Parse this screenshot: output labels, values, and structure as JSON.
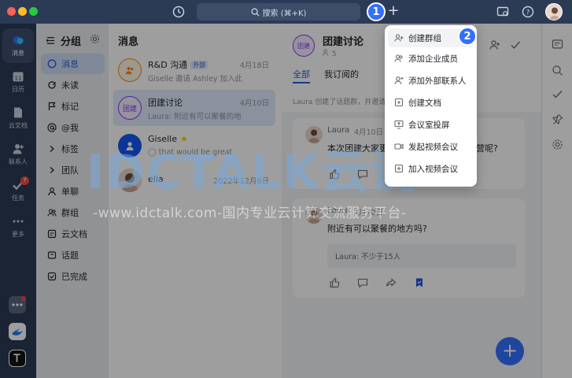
{
  "titlebar": {
    "search_placeholder": "搜索 (⌘+K)",
    "plus_label": "+"
  },
  "rail": {
    "items": [
      {
        "label": "消息",
        "icon": "message-icon",
        "active": true
      },
      {
        "label": "日历",
        "icon": "calendar-icon",
        "calendar_day": "11"
      },
      {
        "label": "云文档",
        "icon": "doc-icon"
      },
      {
        "label": "联系人",
        "icon": "contacts-icon"
      },
      {
        "label": "任务",
        "icon": "task-icon",
        "badge": "7"
      },
      {
        "label": "更多",
        "icon": "more-icon"
      }
    ]
  },
  "groups": {
    "title": "分组",
    "items": [
      {
        "label": "消息",
        "icon": "chat-bubble-icon",
        "active": true
      },
      {
        "label": "未读",
        "icon": "unread-icon"
      },
      {
        "label": "标记",
        "icon": "flag-icon"
      },
      {
        "label": "@我",
        "icon": "at-icon"
      },
      {
        "label": "标签",
        "icon": "tag-icon"
      },
      {
        "label": "团队",
        "icon": "team-icon"
      },
      {
        "label": "单聊",
        "icon": "single-chat-icon"
      },
      {
        "label": "群组",
        "icon": "group-icon"
      },
      {
        "label": "云文档",
        "icon": "cloud-doc-icon"
      },
      {
        "label": "话题",
        "icon": "topic-icon"
      },
      {
        "label": "已完成",
        "icon": "done-icon"
      }
    ]
  },
  "chats": {
    "title": "消息",
    "rows": [
      {
        "name": "R&D 沟通",
        "tag": "外部",
        "preview": "Giselle 邀请 Ashley 加入此群...",
        "date": "4月18日"
      },
      {
        "name": "团建讨论",
        "avatar_text": "团建",
        "preview": "Laura: 附近有可以聚餐的地...",
        "date": "4月10日"
      },
      {
        "name": "Giselle",
        "star": "★",
        "preview": "that would be great",
        "date": "4月10日"
      },
      {
        "name": "elia",
        "preview": "",
        "date": "2022年12月6日"
      }
    ]
  },
  "conversation": {
    "title": "团建讨论",
    "avatar_text": "团建",
    "member_count": "5",
    "tabs": [
      "全部",
      "我订阅的"
    ],
    "system_message": "Laura 创建了话题群，并邀请",
    "messages": [
      {
        "author": "Laura",
        "date": "4月10日",
        "text": "本次团建大家更",
        "text_tail": "营呢?"
      },
      {
        "author": "Laura",
        "date": "4月10日",
        "text": "附近有可以聚餐的地方吗?",
        "reply": "Laura: 不少于15人"
      }
    ],
    "fab": "+"
  },
  "menu": {
    "items": [
      {
        "label": "创建群组",
        "icon": "create-group-icon"
      },
      {
        "label": "添加企业成员",
        "icon": "add-member-icon"
      },
      {
        "label": "添加外部联系人",
        "icon": "add-external-icon"
      },
      {
        "label": "创建文档",
        "icon": "create-doc-icon"
      },
      {
        "label": "会议室投屏",
        "icon": "screen-share-icon"
      },
      {
        "label": "发起视频会议",
        "icon": "video-call-icon"
      },
      {
        "label": "加入视频会议",
        "icon": "join-meeting-icon"
      }
    ]
  },
  "steps": [
    "1",
    "2"
  ],
  "watermark": {
    "brand": "IDCTALK云说",
    "url_line": "-www.idctalk.com-国内专业云计算交流服务平台-"
  },
  "colors": {
    "accent": "#3370ff",
    "rail_bg": "#2b3a55",
    "badge_red": "#f54a45"
  }
}
